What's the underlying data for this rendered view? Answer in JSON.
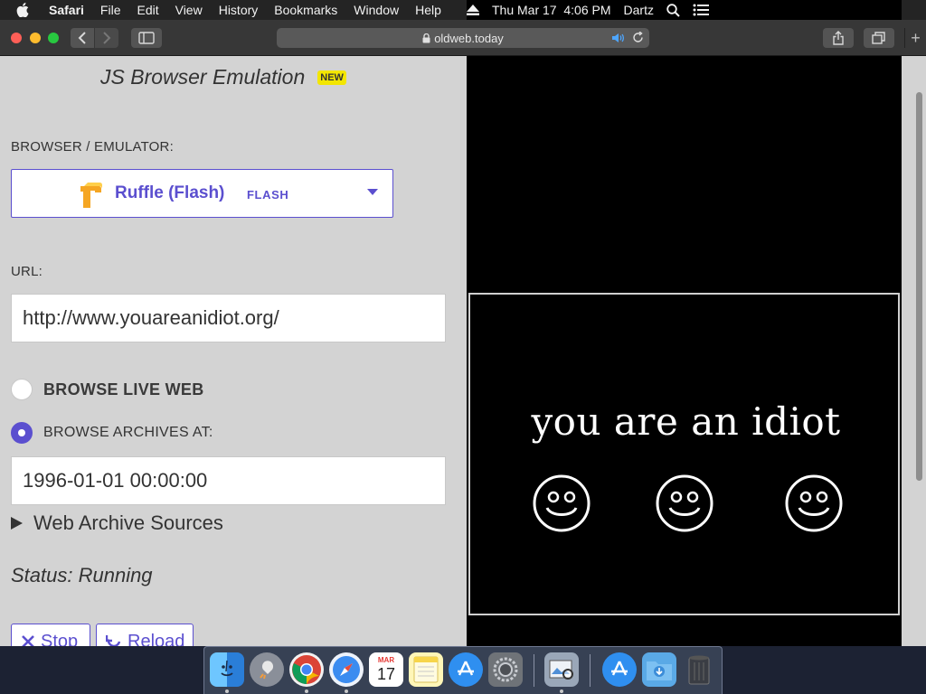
{
  "menubar": {
    "app": "Safari",
    "items": [
      "File",
      "Edit",
      "View",
      "History",
      "Bookmarks",
      "Window",
      "Help"
    ],
    "datetime": "Thu Mar 17  4:06 PM",
    "user": "Dartz"
  },
  "toolbar": {
    "url": "oldweb.today"
  },
  "page": {
    "heading": "JS Browser Emulation",
    "new_badge": "NEW",
    "emulator_label": "BROWSER / EMULATOR:",
    "emulator_name": "Ruffle (Flash)",
    "emulator_tag": "FLASH",
    "url_label": "URL:",
    "url_value": "http://www.youareanidiot.org/",
    "browse_live_label": "BROWSE LIVE WEB",
    "browse_archives_label": "BROWSE ARCHIVES AT:",
    "archive_datetime": "1996-01-01 00:00:00",
    "sources_label": "Web Archive Sources",
    "status": "Status: Running",
    "stop_label": "Stop",
    "reload_label": "Reload"
  },
  "emulator_view": {
    "text": "you are an idiot"
  },
  "colors": {
    "accent": "#5b4fcf",
    "badge": "#f3e600",
    "page_bg": "#d3d3d3"
  },
  "dock": {
    "icons": [
      "finder-icon",
      "launchpad-icon",
      "chrome-icon",
      "safari-icon",
      "calendar-icon",
      "notes-icon",
      "app-store-icon",
      "system-preferences-icon",
      "preview-icon",
      "applications-folder-icon",
      "downloads-folder-icon",
      "trash-icon"
    ],
    "calendar_month": "MAR",
    "calendar_day": "17"
  }
}
